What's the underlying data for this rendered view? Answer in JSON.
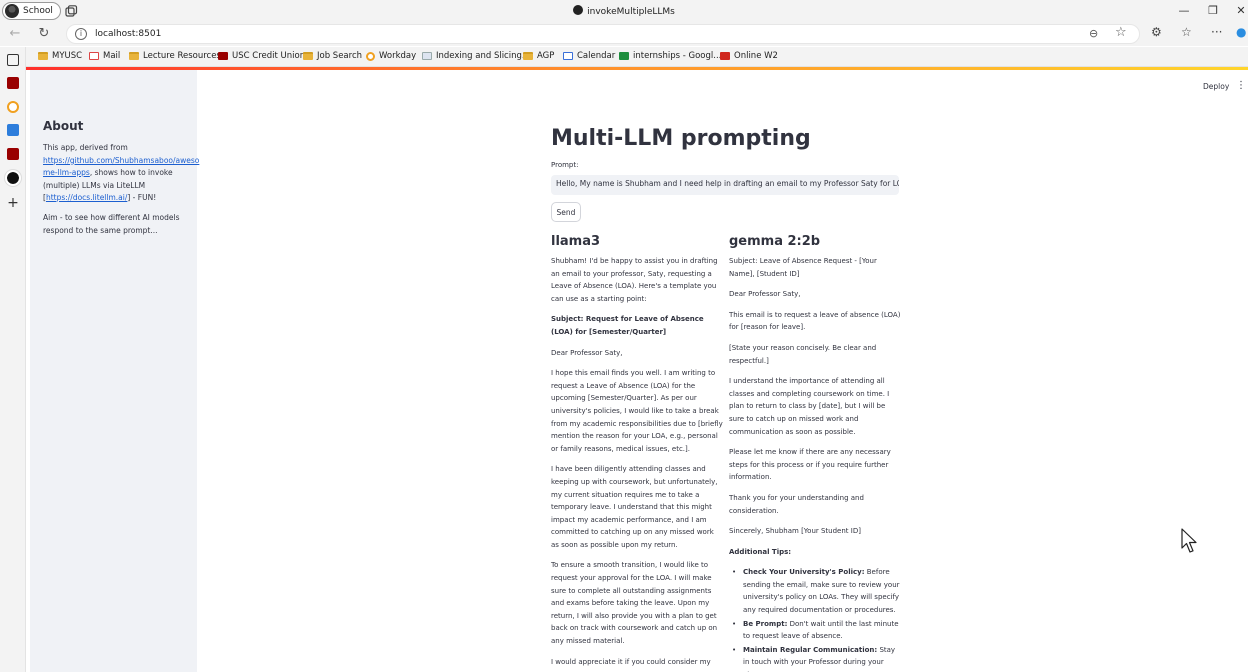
{
  "browser": {
    "profile_label": "School",
    "window_title": "invokeMultipleLLMs",
    "url": "localhost:8501",
    "bookmarks": [
      {
        "label": "MYUSC",
        "icon": "folder"
      },
      {
        "label": "Mail",
        "icon": "gmail"
      },
      {
        "label": "Lecture Resources",
        "icon": "folder"
      },
      {
        "label": "USC Credit Union",
        "icon": "usc"
      },
      {
        "label": "Job Search",
        "icon": "folder"
      },
      {
        "label": "Workday",
        "icon": "workday"
      },
      {
        "label": "Indexing and Slicing...",
        "icon": "doc"
      },
      {
        "label": "AGP",
        "icon": "folder"
      },
      {
        "label": "Calendar",
        "icon": "cal"
      },
      {
        "label": "internships - Googl...",
        "icon": "sheet"
      },
      {
        "label": "Online W2",
        "icon": "adp"
      }
    ]
  },
  "sidebar": {
    "heading": "About",
    "intro_before_link": "This app, derived from ",
    "repo_link": "https://github.com/Shubhamsaboo/awesome-llm-apps",
    "repo_link_line1": "https://github.com/Shubhamsaboo/aweso",
    "repo_link_line2": "me-llm-apps",
    "intro_after_link": ", shows how to invoke (multiple) LLMs via LiteLLM [",
    "docs_link": "https://docs.litellm.ai/",
    "intro_end": "] - FUN!",
    "aim": "Aim - to see how different AI models respond to the same prompt..."
  },
  "header": {
    "deploy_label": "Deploy"
  },
  "main": {
    "title": "Multi-LLM prompting",
    "prompt_label": "Prompt:",
    "prompt_value": "Hello, My name is Shubham and I need help in drafting an email to my Professor Saty for LOA",
    "send_label": "Send"
  },
  "responses": [
    {
      "model": "llama3",
      "paragraphs": [
        {
          "text": "Shubham! I'd be happy to assist you in drafting an email to your professor, Saty, requesting a Leave of Absence (LOA). Here's a template you can use as a starting point:",
          "bold": false
        },
        {
          "text": "Subject: Request for Leave of Absence (LOA) for [Semester/Quarter]",
          "bold": true
        },
        {
          "text": "Dear Professor Saty,",
          "bold": false
        },
        {
          "text": "I hope this email finds you well. I am writing to request a Leave of Absence (LOA) for the upcoming [Semester/Quarter]. As per our university's policies, I would like to take a break from my academic responsibilities due to [briefly mention the reason for your LOA, e.g., personal or family reasons, medical issues, etc.].",
          "bold": false
        },
        {
          "text": "I have been diligently attending classes and keeping up with coursework, but unfortunately, my current situation requires me to take a temporary leave. I understand that this might impact my academic performance, and I am committed to catching up on any missed work as soon as possible upon my return.",
          "bold": false
        },
        {
          "text": "To ensure a smooth transition, I would like to request your approval for the LOA. I will make sure to complete all outstanding assignments and exams before taking the leave. Upon my return, I will also provide you with a plan to get back on track with coursework and catch up on any missed material.",
          "bold": false
        },
        {
          "text": "I would appreciate it if you could consider my",
          "bold": false
        }
      ]
    },
    {
      "model": "gemma 2:2b",
      "paragraphs": [
        {
          "text": "Subject: Leave of Absence Request - [Your Name], [Student ID]",
          "bold": false
        },
        {
          "text": "Dear Professor Saty,",
          "bold": false
        },
        {
          "text": "This email is to request a leave of absence (LOA) for [reason for leave].",
          "bold": false
        },
        {
          "text": "[State your reason concisely. Be clear and respectful.]",
          "bold": false
        },
        {
          "text": "I understand the importance of attending all classes and completing coursework on time. I plan to return to class by [date], but I will be sure to catch up on missed work and communication as soon as possible.",
          "bold": false
        },
        {
          "text": "Please let me know if there are any necessary steps for this process or if you require further information.",
          "bold": false
        },
        {
          "text": "Thank you for your understanding and consideration.",
          "bold": false
        },
        {
          "text": "Sincerely, Shubham [Your Student ID]",
          "bold": false
        },
        {
          "text": "Additional Tips:",
          "bold": true
        }
      ],
      "tips": [
        {
          "title": "Check Your University's Policy:",
          "text": " Before sending the email, make sure to review your university's policy on LOAs. They will specify any required documentation or procedures."
        },
        {
          "title": "Be Prompt:",
          "text": " Don't wait until the last minute to request leave of absence."
        },
        {
          "title": "Maintain Regular Communication:",
          "text": " Stay in touch with your Professor during your absence."
        }
      ]
    }
  ]
}
